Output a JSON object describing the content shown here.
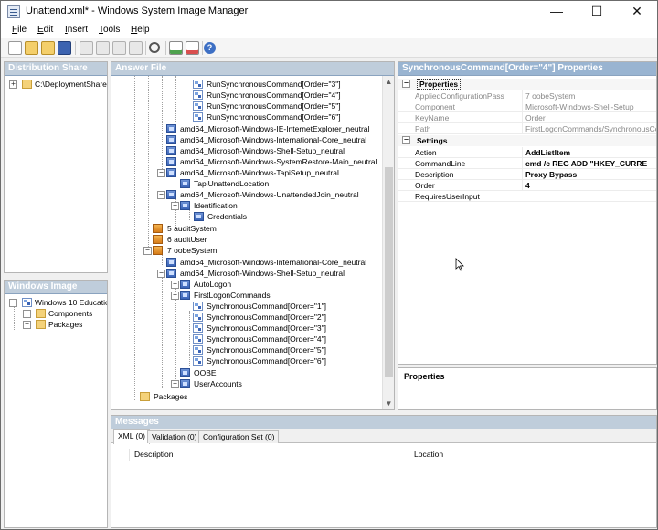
{
  "window": {
    "title": "Unattend.xml* - Windows System Image Manager",
    "controls": {
      "minimize": "—",
      "maximize": "☐",
      "close": "✕"
    }
  },
  "menu": [
    {
      "label": "File",
      "mnemonic": "F",
      "rest": "ile"
    },
    {
      "label": "Edit",
      "mnemonic": "E",
      "rest": "dit"
    },
    {
      "label": "Insert",
      "mnemonic": "I",
      "rest": "nsert"
    },
    {
      "label": "Tools",
      "mnemonic": "T",
      "rest": "ools"
    },
    {
      "label": "Help",
      "mnemonic": "H",
      "rest": "elp"
    }
  ],
  "toolbar": {
    "icons": [
      "new-icon",
      "open-icon",
      "open-folder-icon",
      "save-icon",
      "cut-icon",
      "copy-icon",
      "paste-icon",
      "delete-icon",
      "find-icon",
      "validate-icon",
      "create-config-icon",
      "help-icon"
    ]
  },
  "distribution_share": {
    "header": "Distribution Share",
    "root": "C:\\DeploymentShare",
    "root_expander": "+"
  },
  "windows_image": {
    "header": "Windows Image",
    "root": "Windows 10 Educatio",
    "children": [
      "Components",
      "Packages"
    ]
  },
  "answer_file": {
    "header": "Answer File",
    "rows": [
      "RunSynchronousCommand[Order=\"3\"]",
      "RunSynchronousCommand[Order=\"4\"]",
      "RunSynchronousCommand[Order=\"5\"]",
      "RunSynchronousCommand[Order=\"6\"]",
      "amd64_Microsoft-Windows-IE-InternetExplorer_neutral",
      "amd64_Microsoft-Windows-International-Core_neutral",
      "amd64_Microsoft-Windows-Shell-Setup_neutral",
      "amd64_Microsoft-Windows-SystemRestore-Main_neutral",
      "amd64_Microsoft-Windows-TapiSetup_neutral",
      "TapiUnattendLocation",
      "amd64_Microsoft-Windows-UnattendedJoin_neutral",
      "Identification",
      "Credentials",
      "5 auditSystem",
      "6 auditUser",
      "7 oobeSystem",
      "amd64_Microsoft-Windows-International-Core_neutral",
      "amd64_Microsoft-Windows-Shell-Setup_neutral",
      "AutoLogon",
      "FirstLogonCommands",
      "SynchronousCommand[Order=\"1\"]",
      "SynchronousCommand[Order=\"2\"]",
      "SynchronousCommand[Order=\"3\"]",
      "SynchronousCommand[Order=\"4\"]",
      "SynchronousCommand[Order=\"5\"]",
      "SynchronousCommand[Order=\"6\"]",
      "OOBE",
      "UserAccounts",
      "Packages"
    ],
    "expander_plus": "+",
    "expander_minus": "−",
    "scroll_up": "▲",
    "scroll_down": "▼"
  },
  "properties_pane": {
    "header": "SynchronousCommand[Order=\"4\"] Properties",
    "groups": {
      "properties": "Properties",
      "settings": "Settings",
      "expander": "−"
    },
    "readonly": [
      {
        "name": "AppliedConfigurationPass",
        "value": "7 oobeSystem"
      },
      {
        "name": "Component",
        "value": "Microsoft-Windows-Shell-Setup"
      },
      {
        "name": "KeyName",
        "value": "Order"
      },
      {
        "name": "Path",
        "value": "FirstLogonCommands/SynchronousComm"
      }
    ],
    "settings": [
      {
        "name": "Action",
        "value": "AddListItem"
      },
      {
        "name": "CommandLine",
        "value": "cmd /c REG ADD \"HKEY_CURRE"
      },
      {
        "name": "Description",
        "value": "Proxy Bypass"
      },
      {
        "name": "Order",
        "value": "4"
      },
      {
        "name": "RequiresUserInput",
        "value": ""
      }
    ]
  },
  "properties_help": {
    "header": "Properties"
  },
  "messages": {
    "header": "Messages",
    "tabs": [
      "XML (0)",
      "Validation (0)",
      "Configuration Set (0)"
    ],
    "columns": [
      "Description",
      "Location"
    ]
  }
}
